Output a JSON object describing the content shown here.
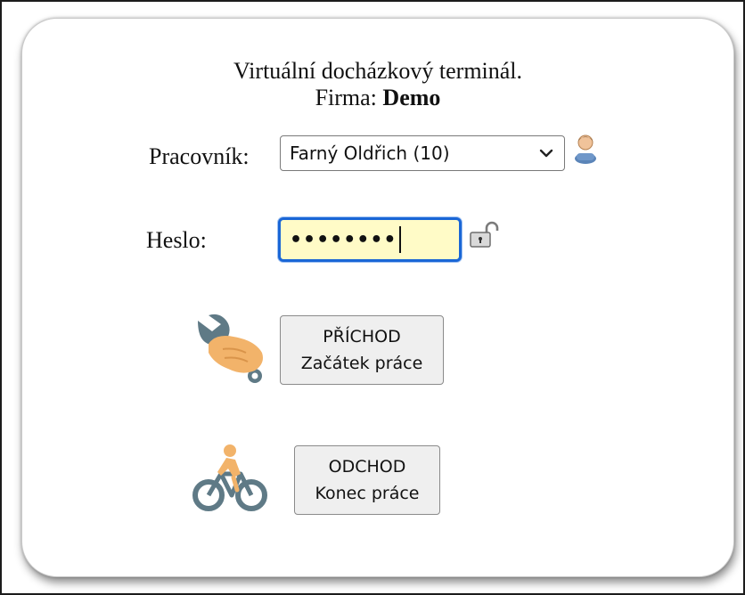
{
  "header": {
    "title": "Virtuální docházkový terminál.",
    "company_label": "Firma:",
    "company_name": "Demo"
  },
  "worker": {
    "label": "Pracovník:",
    "selected": "Farný Oldřich (10)",
    "icon": "user-icon"
  },
  "password": {
    "label": "Heslo:",
    "masked_value": "••••••••",
    "icon": "unlock-icon"
  },
  "arrival_button": {
    "line1": "PŘÍCHOD",
    "line2": "Začátek práce",
    "icon": "wrench-hand-icon"
  },
  "departure_button": {
    "line1": "ODCHOD",
    "line2": "Konec práce",
    "icon": "bicycle-icon"
  },
  "colors": {
    "focus_border": "#1a66d6",
    "password_bg": "#fffbc7",
    "button_bg": "#efefef",
    "hand_skin": "#f2b36a",
    "tool_gray": "#5f7a86"
  }
}
